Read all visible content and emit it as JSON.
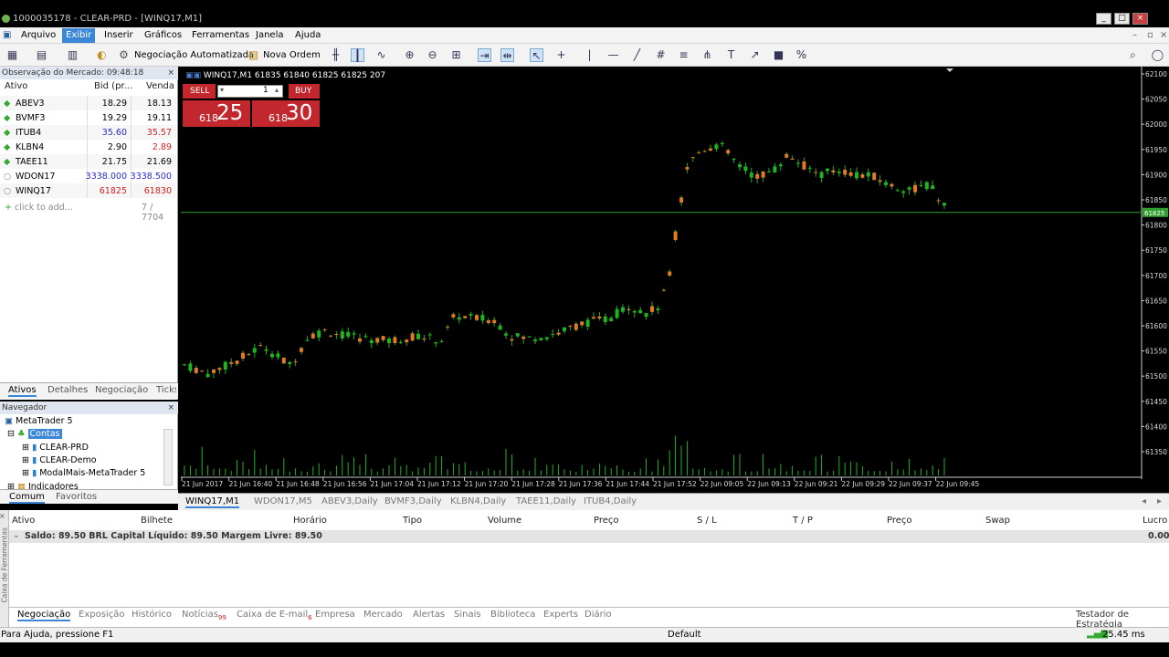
{
  "window": {
    "title": "1000035178 - CLEAR-PRD - [WINQ17,M1]",
    "min": "_",
    "max": "□",
    "close": "×"
  },
  "menu": [
    "Arquivo",
    "Exibir",
    "Inserir",
    "Gráficos",
    "Ferramentas",
    "Janela",
    "Ajuda"
  ],
  "toolbar": {
    "auto_trading": "Negociação Automatizada",
    "new_order": "Nova Ordem"
  },
  "market_watch": {
    "title": "Observação do Mercado: 09:48:18",
    "close": "×",
    "cols": [
      "Ativo",
      "Bid (pr...",
      "Venda"
    ],
    "rows": [
      {
        "sym": "ABEV3",
        "bid": "18.29",
        "ask": "18.13",
        "bidColor": "#000000",
        "askColor": "#000000"
      },
      {
        "sym": "BVMF3",
        "bid": "19.29",
        "ask": "19.11",
        "bidColor": "#000000",
        "askColor": "#000000"
      },
      {
        "sym": "ITUB4",
        "bid": "35.60",
        "ask": "35.57",
        "bidColor": "#2a2ad0",
        "askColor": "#d02020"
      },
      {
        "sym": "KLBN4",
        "bid": "2.90",
        "ask": "2.89",
        "bidColor": "#000000",
        "askColor": "#d02020"
      },
      {
        "sym": "TAEE11",
        "bid": "21.75",
        "ask": "21.69",
        "bidColor": "#000000",
        "askColor": "#000000"
      },
      {
        "sym": "WDON17",
        "bid": "3338.000",
        "ask": "3338.500",
        "bidColor": "#2a2ad0",
        "askColor": "#2a2ad0"
      },
      {
        "sym": "WINQ17",
        "bid": "61825",
        "ask": "61830",
        "bidColor": "#d02020",
        "askColor": "#d02020"
      }
    ],
    "add": "click to add...",
    "count": "7 / 7704",
    "tabs": [
      "Ativos",
      "Detalhes",
      "Negociação",
      "Ticks"
    ]
  },
  "navigator": {
    "title": "Navegador",
    "close": "×",
    "root": "MetaTrader 5",
    "accounts": "Contas",
    "items": [
      "CLEAR-PRD",
      "CLEAR-Demo",
      "ModalMais-MetaTrader 5"
    ],
    "indicators": "Indicadores",
    "tabs": [
      "Comum",
      "Favoritos"
    ]
  },
  "chart": {
    "header": "WINQ17,M1  61835 61840 61825 61825  207",
    "sell": "SELL",
    "buy": "BUY",
    "qty": "1",
    "sell_big": "25",
    "sell_small": "618",
    "buy_big": "30",
    "buy_small": "618",
    "current_price": "61825",
    "y_labels": [
      "62100",
      "62050",
      "62000",
      "61950",
      "61900",
      "61850",
      "61800",
      "61750",
      "61700",
      "61650",
      "61600",
      "61550",
      "61500",
      "61450",
      "61400",
      "61350"
    ],
    "x_labels": [
      "21 Jun 2017",
      "21 Jun 16:40",
      "21 Jun 16:48",
      "21 Jun 16:56",
      "21 Jun 17:04",
      "21 Jun 17:12",
      "21 Jun 17:20",
      "21 Jun 17:28",
      "21 Jun 17:36",
      "21 Jun 17:44",
      "21 Jun 17:52",
      "22 Jun 09:05",
      "22 Jun 09:13",
      "22 Jun 09:21",
      "22 Jun 09:29",
      "22 Jun 09:37",
      "22 Jun 09:45"
    ]
  },
  "chart_tabs": [
    "WINQ17,M1",
    "WDON17,M5",
    "ABEV3,Daily",
    "BVMF3,Daily",
    "KLBN4,Daily",
    "TAEE11,Daily",
    "ITUB4,Daily"
  ],
  "toolbox": {
    "cols": [
      "Ativo",
      "Bilhete",
      "Horário",
      "Tipo",
      "Volume",
      "Preço",
      "S / L",
      "T / P",
      "Preço",
      "Swap",
      "Lucro"
    ],
    "balance": "Saldo: 89.50 BRL  Capital Líquido: 89.50  Margem Livre: 89.50",
    "profit": "0.00",
    "tabs": [
      "Negociação",
      "Exposição",
      "Histórico",
      "Notícias",
      "Caixa de E-mail",
      "Empresa",
      "Mercado",
      "Alertas",
      "Sinais",
      "Biblioteca",
      "Experts",
      "Diário"
    ],
    "news_badge": "99",
    "mail_badge": "6",
    "tester": "Testador de Estratégia",
    "side_label": "Caixa de Ferramentas"
  },
  "status": {
    "help": "Para Ajuda, pressione F1",
    "profile": "Default",
    "ping": "25.45 ms"
  }
}
